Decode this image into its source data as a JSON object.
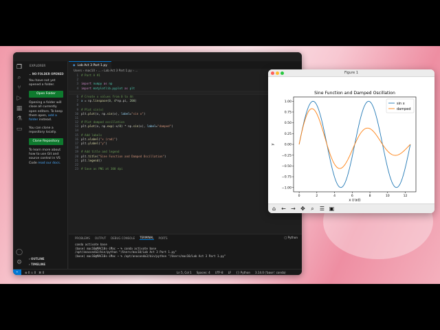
{
  "vscode": {
    "sidebar": {
      "title": "EXPLORER",
      "section": "NO FOLDER OPENED",
      "text1": "You have not yet opened a folder.",
      "open_folder": "Open Folder",
      "text2_a": "Opening a folder will close all currently open editors. To keep them open,",
      "text2_link": "add a folder",
      "text2_b": "instead.",
      "text3": "You can clone a repository locally.",
      "clone_repo": "Clone Repository",
      "text4_a": "To learn more about how to use Git and source control in VS Code",
      "text4_link": "read our docs.",
      "outline": "OUTLINE",
      "timeline": "TIMELINE"
    },
    "tab": {
      "label": "Lab Act 3 Part 1.py"
    },
    "breadcrumb": "Users › mac10 › ... › Lab Act 3 Part 1.py › ...",
    "code_lines": [
      {
        "n": "1",
        "parts": [
          [
            "cm",
            "# Part A #1"
          ]
        ]
      },
      {
        "n": "2",
        "parts": []
      },
      {
        "n": "3",
        "parts": [
          [
            "kw",
            "import "
          ],
          [
            "md",
            "numpy"
          ],
          [
            "kw",
            " as "
          ],
          [
            "md",
            "np"
          ]
        ]
      },
      {
        "n": "4",
        "parts": [
          [
            "kw",
            "import "
          ],
          [
            "md",
            "matplotlib.pyplot"
          ],
          [
            "kw",
            " as "
          ],
          [
            "md",
            "plt"
          ]
        ]
      },
      {
        "n": "5",
        "parts": []
      },
      {
        "n": "6",
        "parts": [
          [
            "cm",
            "# Create x values from 0 to 4π"
          ]
        ]
      },
      {
        "n": "7",
        "parts": [
          [
            "vr",
            "x"
          ],
          [
            "src",
            " = np."
          ],
          [
            "fn",
            "linspace"
          ],
          [
            "src",
            "("
          ],
          [
            "nm",
            "0"
          ],
          [
            "src",
            ", "
          ],
          [
            "nm",
            "4"
          ],
          [
            "src",
            "*np.pi, "
          ],
          [
            "nm",
            "200"
          ],
          [
            "src",
            ")"
          ]
        ]
      },
      {
        "n": "8",
        "parts": []
      },
      {
        "n": "9",
        "parts": [
          [
            "cm",
            "# Plot sin(x)"
          ]
        ]
      },
      {
        "n": "10",
        "parts": [
          [
            "src",
            "plt."
          ],
          [
            "fn",
            "plot"
          ],
          [
            "src",
            "(x, np."
          ],
          [
            "fn",
            "sin"
          ],
          [
            "src",
            "(x), "
          ],
          [
            "vr",
            "label"
          ],
          [
            "src",
            "="
          ],
          [
            "st",
            "\"sin x\""
          ],
          [
            "src",
            ")"
          ]
        ]
      },
      {
        "n": "11",
        "parts": []
      },
      {
        "n": "12",
        "parts": [
          [
            "cm",
            "# Plot damped oscillation"
          ]
        ]
      },
      {
        "n": "13",
        "parts": [
          [
            "src",
            "plt."
          ],
          [
            "fn",
            "plot"
          ],
          [
            "src",
            "(x, np."
          ],
          [
            "fn",
            "exp"
          ],
          [
            "src",
            "(-x/"
          ],
          [
            "nm",
            "8"
          ],
          [
            "src",
            ") * np."
          ],
          [
            "fn",
            "sin"
          ],
          [
            "src",
            "(x), "
          ],
          [
            "vr",
            "label"
          ],
          [
            "src",
            "="
          ],
          [
            "st",
            "\"damped\""
          ],
          [
            "src",
            ")"
          ]
        ]
      },
      {
        "n": "14",
        "parts": []
      },
      {
        "n": "15",
        "parts": [
          [
            "cm",
            "# Add labels"
          ]
        ]
      },
      {
        "n": "16",
        "parts": [
          [
            "src",
            "plt."
          ],
          [
            "fn",
            "xlabel"
          ],
          [
            "src",
            "("
          ],
          [
            "st",
            "\"x (rad)\""
          ],
          [
            "src",
            ")"
          ]
        ]
      },
      {
        "n": "17",
        "parts": [
          [
            "src",
            "plt."
          ],
          [
            "fn",
            "ylabel"
          ],
          [
            "src",
            "("
          ],
          [
            "st",
            "\"y\""
          ],
          [
            "src",
            ")"
          ]
        ]
      },
      {
        "n": "18",
        "parts": []
      },
      {
        "n": "19",
        "parts": [
          [
            "cm",
            "# Add title and legend"
          ]
        ]
      },
      {
        "n": "20",
        "parts": [
          [
            "src",
            "plt."
          ],
          [
            "fn",
            "title"
          ],
          [
            "src",
            "("
          ],
          [
            "st",
            "\"Sine Function and Damped Oscillation\""
          ],
          [
            "src",
            ")"
          ]
        ]
      },
      {
        "n": "21",
        "parts": [
          [
            "src",
            "plt."
          ],
          [
            "fn",
            "legend"
          ],
          [
            "src",
            "()"
          ]
        ]
      },
      {
        "n": "22",
        "parts": []
      },
      {
        "n": "23",
        "parts": [
          [
            "cm",
            "# Save as PNG at 300 dpi"
          ]
        ]
      }
    ],
    "panel": {
      "tabs": [
        "PROBLEMS",
        "OUTPUT",
        "DEBUG CONSOLE",
        "TERMINAL",
        "PORTS"
      ],
      "active_tab": "TERMINAL",
      "shell": "Python",
      "terminal_lines": [
        "conda activate base",
        "(base) mac10@MAC10s-iMac ~ % conda activate base",
        "/opt/anaconda3/bin/python \"/Users/mac10/Lab Act 3 Part 1.py\"",
        "(base) mac10@MAC10s-iMac ~ % /opt/anaconda3/bin/python \"/Users/mac10/Lab Act 3 Part 1.py\""
      ]
    },
    "status": {
      "errors": "0",
      "warnings": "0",
      "ports": "0",
      "position": "Ln 5, Col 1",
      "spaces": "Spaces: 4",
      "encoding": "UTF-8",
      "eol": "LF",
      "language": "{} Python",
      "interpreter": "3.14.0 ('base': conda)"
    }
  },
  "figure": {
    "window_title": "Figure 1"
  },
  "chart_data": {
    "type": "line",
    "title": "Sine Function and Damped Oscillation",
    "xlabel": "x (rad)",
    "ylabel": "y",
    "xlim": [
      -0.63,
      13.2
    ],
    "ylim": [
      -1.1,
      1.1
    ],
    "xticks": [
      0,
      2,
      4,
      6,
      8,
      10,
      12
    ],
    "yticks": [
      -1.0,
      -0.75,
      -0.5,
      -0.25,
      0.0,
      0.25,
      0.5,
      0.75,
      1.0
    ],
    "ytick_labels": [
      "−1.00",
      "−0.75",
      "−0.50",
      "−0.25",
      "0.00",
      "0.25",
      "0.50",
      "0.75",
      "1.00"
    ],
    "legend_position": "upper right",
    "series": [
      {
        "name": "sin x",
        "color": "#1f77b4",
        "formula": "sin(x)",
        "x_range": [
          0,
          12.566
        ],
        "points": 200
      },
      {
        "name": "damped",
        "color": "#ff7f0e",
        "formula": "exp(-x/8) * sin(x)",
        "x_range": [
          0,
          12.566
        ],
        "points": 200
      }
    ]
  }
}
